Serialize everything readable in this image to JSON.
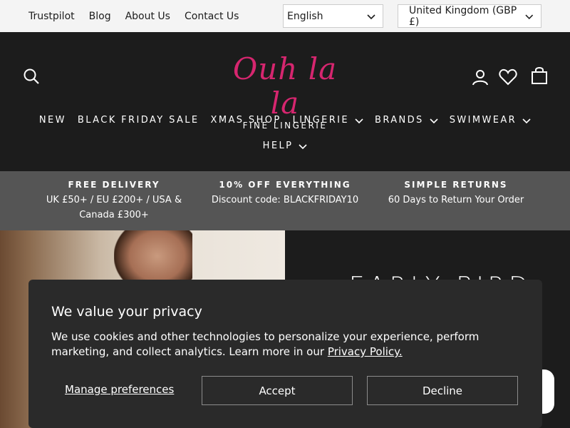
{
  "topbar": {
    "links": [
      "Trustpilot",
      "Blog",
      "About Us",
      "Contact Us"
    ],
    "language": "English",
    "country": "United Kingdom (GBP £)"
  },
  "brand": {
    "name": "Ouh la la",
    "tagline": "FINE LINGERIE"
  },
  "icons": {
    "search": "search-icon",
    "account": "user-icon",
    "wishlist": "heart-icon",
    "cart": "bag-icon",
    "dropdown": "chevron-down-icon"
  },
  "nav": {
    "row1": [
      "NEW",
      "BLACK FRIDAY SALE",
      "XMAS SHOP",
      "LINGERIE",
      "BRANDS",
      "SWIMWEAR"
    ],
    "row2": [
      "HELP"
    ]
  },
  "benefits": [
    {
      "title": "FREE DELIVERY",
      "text": "UK £50+ / EU £200+ / USA & Canada £300+"
    },
    {
      "title": "10% OFF EVERYTHING",
      "text": "Discount code: BLACKFRIDAY10"
    },
    {
      "title": "SIMPLE RETURNS",
      "text": "60 Days to Return Your Order"
    }
  ],
  "hero": {
    "heading": "EARLY BIRD"
  },
  "cookie": {
    "title": "We value your privacy",
    "text": "We use cookies and other technologies to personalize your experience, perform marketing, and collect analytics. Learn more in our",
    "link": "Privacy Policy.",
    "manage": "Manage preferences",
    "accept": "Accept",
    "decline": "Decline"
  },
  "colors": {
    "brand_pink": "#d6266f",
    "header_bg": "#1c1c1c",
    "benefits_bg": "#555555"
  }
}
